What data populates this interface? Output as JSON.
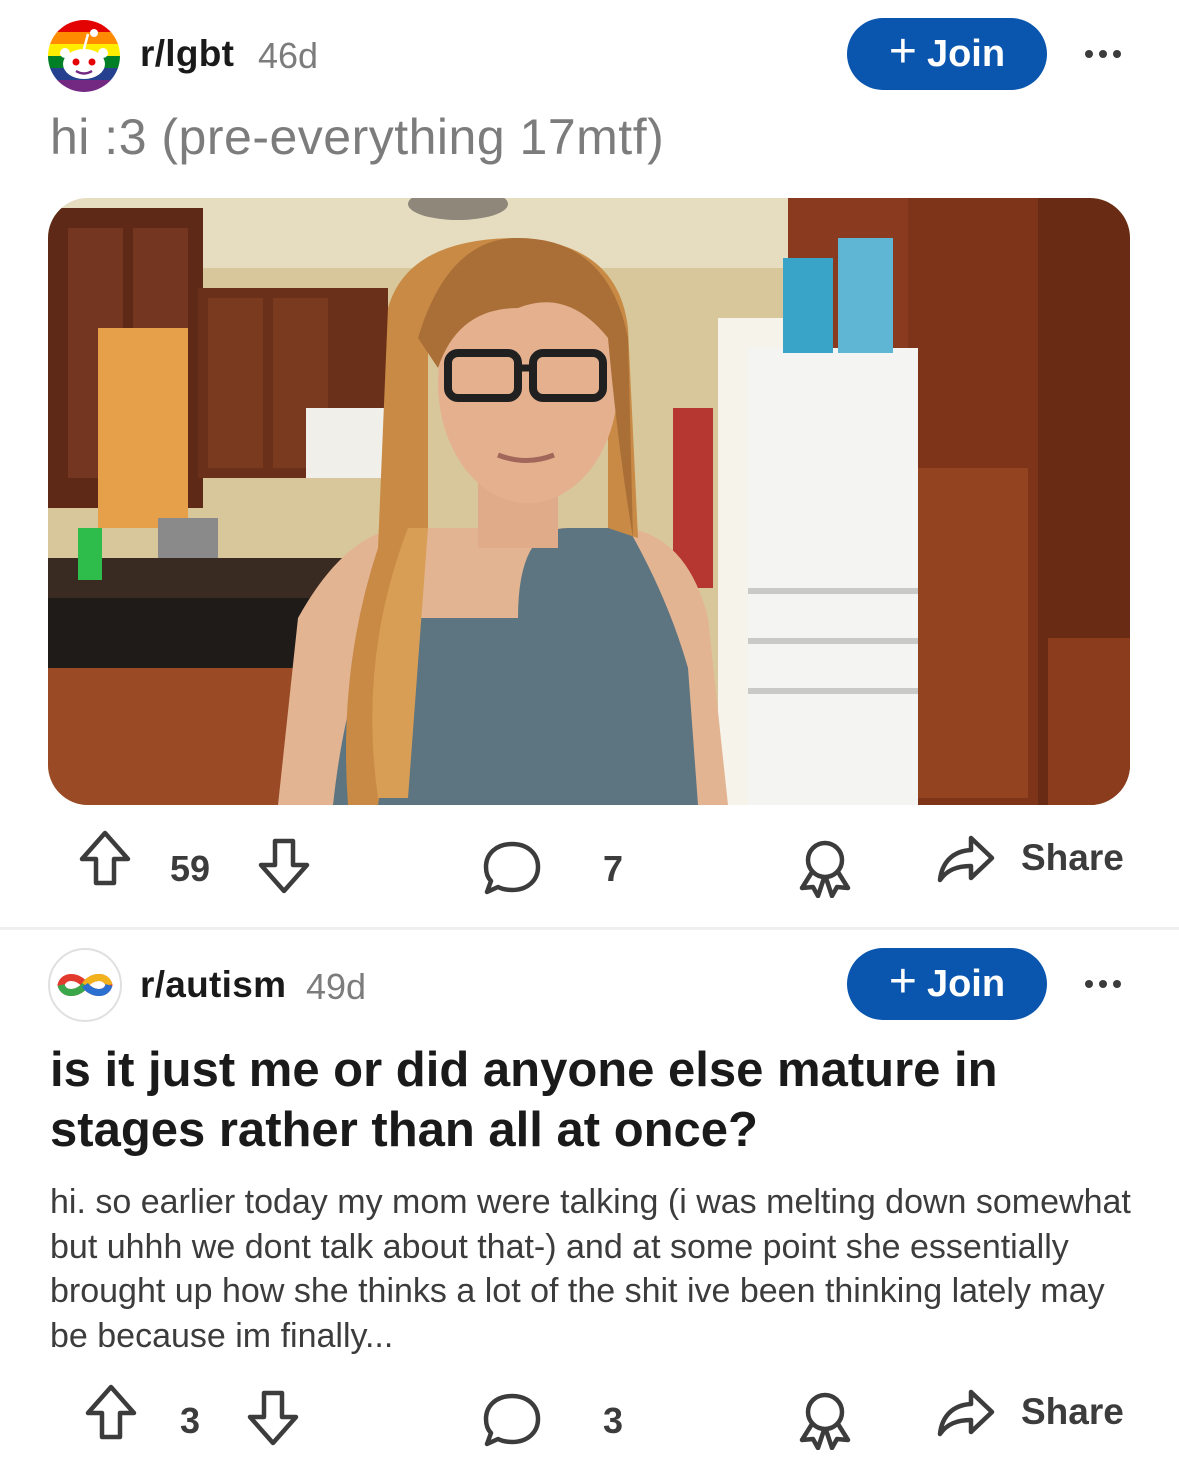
{
  "posts": [
    {
      "subreddit": "r/lgbt",
      "age": "46d",
      "join_label": "Join",
      "title": "hi :3 (pre-everything 17mtf)",
      "upvotes": "59",
      "comments": "7",
      "share_label": "Share",
      "icons": {
        "avatar": "rainbow-snoo-avatar",
        "upvote": "arrow-up-icon",
        "downvote": "arrow-down-icon",
        "comment": "speech-bubble-icon",
        "award": "award-ribbon-icon",
        "share": "share-arrow-icon",
        "more": "ellipsis-icon"
      }
    },
    {
      "subreddit": "r/autism",
      "age": "49d",
      "join_label": "Join",
      "title": "is it just me or did anyone else mature in stages rather than all at once?",
      "body": "hi. so earlier today my mom were talking (i was melting down somewhat but uhhh we dont talk about that-) and at some point she essentially brought up how she thinks a lot of the shit ive been thinking lately may be because im finally...",
      "upvotes": "3",
      "comments": "3",
      "share_label": "Share",
      "icons": {
        "avatar": "infinity-symbol-avatar",
        "upvote": "arrow-up-icon",
        "downvote": "arrow-down-icon",
        "comment": "speech-bubble-icon",
        "award": "award-ribbon-icon",
        "share": "share-arrow-icon",
        "more": "ellipsis-icon"
      }
    }
  ],
  "colors": {
    "join_button": "#0a55ad",
    "muted_text": "#7c7c7c",
    "title_text": "#1a1a1b",
    "action_text": "#3c3c3c"
  }
}
